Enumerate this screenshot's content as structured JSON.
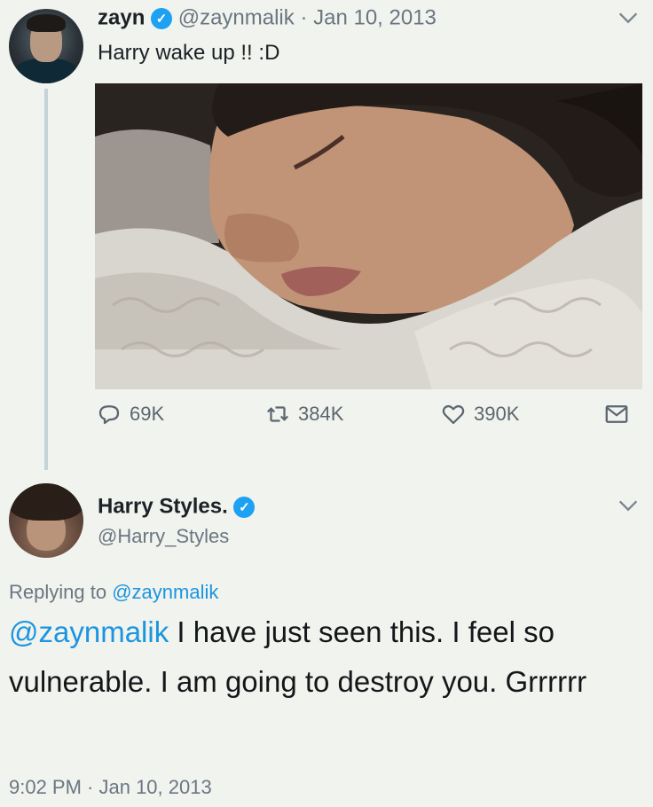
{
  "tweet": {
    "author_name": "zayn",
    "author_handle": "@zaynmalik",
    "separator": "·",
    "date": "Jan 10, 2013",
    "text": "Harry wake up !! :D",
    "actions": {
      "replies": "69K",
      "retweets": "384K",
      "likes": "390K"
    }
  },
  "reply": {
    "author_name": "Harry Styles.",
    "author_handle": "@Harry_Styles",
    "replying_prefix": "Replying to",
    "replying_to": "@zaynmalik",
    "mention": "@zaynmalik",
    "text": " I have just seen this. I feel so vulnerable. I am going to destroy you. Grrrrrr",
    "time": "9:02 PM · Jan 10, 2013"
  },
  "icons": {
    "verified": "verified-badge-icon",
    "chevron": "chevron-down-icon",
    "reply": "reply-icon",
    "retweet": "retweet-icon",
    "like": "heart-icon",
    "dm": "envelope-icon"
  },
  "colors": {
    "background": "#f1f3ee",
    "link": "#1b95e0",
    "verified": "#1da1f2",
    "muted": "#6a7681"
  }
}
